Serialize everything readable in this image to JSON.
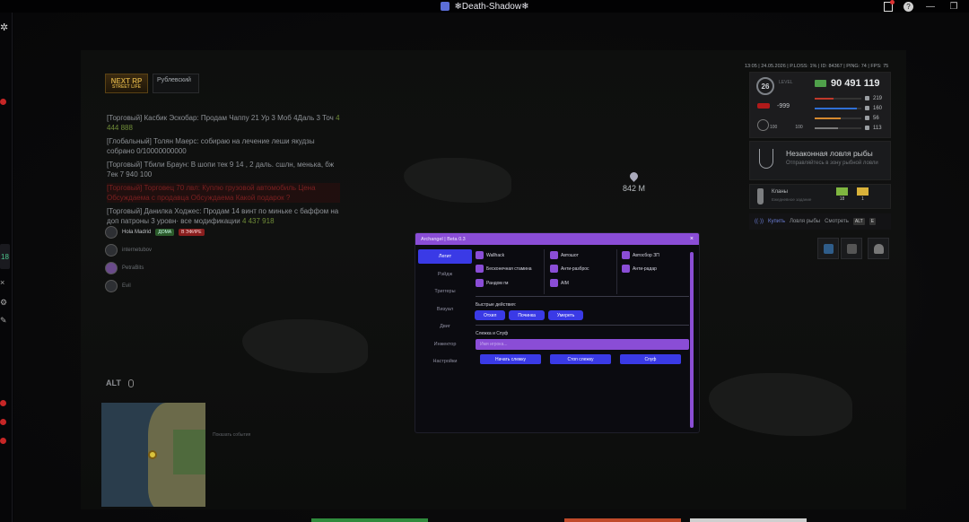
{
  "window": {
    "title": "❄Death-Shadow❄"
  },
  "hud": {
    "logo_line1": "NEXT RP",
    "logo_line2": "STREET LIFE",
    "server_name": "Рублевский",
    "status_line": "13:05 | 24.05.2026 | P.LOSS: 1% | ID: 84367 | PING: 74 | FPS: 75",
    "level": "26",
    "level_sub": "LEVEL",
    "money": "90 491 119",
    "negative": "-999",
    "stats": [
      {
        "value": "219",
        "color": "#c0392b",
        "fill": 0.4
      },
      {
        "value": "160",
        "color": "#2f6fd6",
        "fill": 0.9
      },
      {
        "value": "56",
        "color": "#d68a2f",
        "fill": 0.55
      },
      {
        "value": "113",
        "color": "#7a7a7a",
        "fill": 0.5
      }
    ],
    "hp_values": [
      "100",
      "100"
    ],
    "distance": "842 M",
    "quest": {
      "title": "Незаконная ловля рыбы",
      "subtitle": "Отправляйтесь в зону рыбной ловли"
    },
    "clans": {
      "title": "Кланы",
      "sub": "Ежедневное задание",
      "tickets": [
        {
          "count": "18",
          "color": "#7fb640"
        },
        {
          "count": "1",
          "color": "#d9b23a"
        }
      ]
    },
    "fish_bar": {
      "label1": "Ловля рыбы",
      "label2": "Смотреть",
      "accent": "Купить",
      "key1": "ALT",
      "key2": "E"
    },
    "alt_label": "ALT",
    "minimap_hint": "Показать события"
  },
  "chat": [
    {
      "text": "[Торговый] Касбик Эскобар: Продам Чаппу 21 Ур 3 Моб 4Даль 3 Точ",
      "money": "4 444 888",
      "style": "normal"
    },
    {
      "text": "[Глобальный] Толян Маерс: собираю на лечение леши якудзы собрано 0/10000000000",
      "money": "",
      "style": "normal"
    },
    {
      "text": "[Торговый] Тбили Браун: В шопи тек 9 14 , 2 даль. сшлн, менька, бж 7ек 7 940 100",
      "money": "",
      "style": "normal"
    },
    {
      "text": "[Торговый] Торговец 70 лвл: Куплю грузовой автомобиль Цена Обсуждаема с продавца Обсуждаема Какой подарок ?",
      "money": "",
      "style": "red"
    },
    {
      "text": "[Торговый] Данилка Ходжес: Продам 14 винт по миньке с баффом на доп патроны 3 уровн· все модификации",
      "money": "4 437 918",
      "style": "normal"
    }
  ],
  "players": [
    {
      "name": "Hola Madrid",
      "tag1": "ДОМА",
      "tag2": "В ЭФИРЕ"
    },
    {
      "name": "internetubov",
      "tag1": "",
      "tag2": ""
    },
    {
      "name": "PetraBits",
      "tag1": "",
      "tag2": ""
    },
    {
      "name": "Evil",
      "tag1": "",
      "tag2": ""
    }
  ],
  "menu": {
    "title": "Archangel | Beta 0.3",
    "close": "×",
    "nav": [
      "Легит",
      "Рэйдж",
      "Триггеры",
      "Визуал",
      "Двиг",
      "Инжектор",
      "Настройки"
    ],
    "features_col1": [
      "Wallhack",
      "Бесконечная стамина",
      "Рандом гм"
    ],
    "features_col2": [
      "Автошот",
      "Анти-разброс",
      "AIM"
    ],
    "features_col3": [
      "Автосбор ЗП",
      "Анти-радар"
    ],
    "quick_label": "Быстрые действия:",
    "quick_buttons": [
      "Отхил",
      "Починка",
      "Умереть"
    ],
    "spy_label": "Слежка и Спуф",
    "spy_placeholder": "Имя игрока...",
    "spy_buttons": [
      "Начать слежку",
      "Стоп слежку",
      "Спуф"
    ]
  },
  "colors": {
    "accent_purple": "#8a4dd6",
    "accent_blue": "#3a3ae6"
  }
}
